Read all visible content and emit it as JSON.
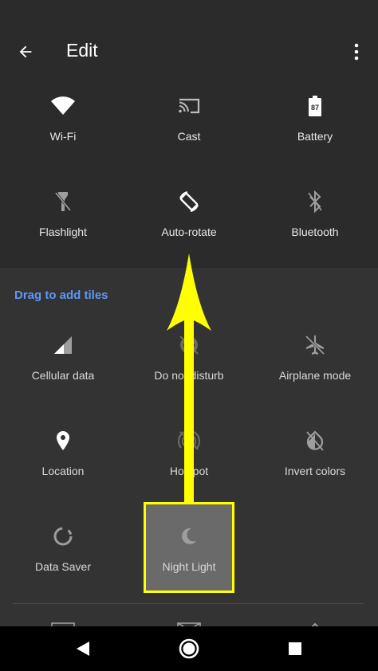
{
  "header": {
    "title": "Edit"
  },
  "active_tiles": [
    {
      "label": "Wi-Fi",
      "icon": "wifi-icon"
    },
    {
      "label": "Cast",
      "icon": "cast-icon"
    },
    {
      "label": "Battery",
      "icon": "battery-icon",
      "battery_level": "87"
    },
    {
      "label": "Flashlight",
      "icon": "flashlight-icon"
    },
    {
      "label": "Auto-rotate",
      "icon": "auto-rotate-icon"
    },
    {
      "label": "Bluetooth",
      "icon": "bluetooth-icon"
    }
  ],
  "available": {
    "heading": "Drag to add tiles",
    "tiles": [
      {
        "label": "Cellular data",
        "icon": "cellular-icon"
      },
      {
        "label": "Do not disturb",
        "icon": "do-not-disturb-icon"
      },
      {
        "label": "Airplane mode",
        "icon": "airplane-icon"
      },
      {
        "label": "Location",
        "icon": "location-icon"
      },
      {
        "label": "Hotspot",
        "icon": "hotspot-icon"
      },
      {
        "label": "Invert colors",
        "icon": "invert-colors-icon"
      },
      {
        "label": "Data Saver",
        "icon": "data-saver-icon"
      },
      {
        "label": "Night Light",
        "icon": "night-light-icon"
      }
    ]
  },
  "annotation": {
    "arrow_color": "#ffff00",
    "highlight_color": "#ffff00"
  },
  "colors": {
    "accent": "#5e97f6",
    "top_bg": "#2b2b2b",
    "bottom_bg": "#333333"
  }
}
